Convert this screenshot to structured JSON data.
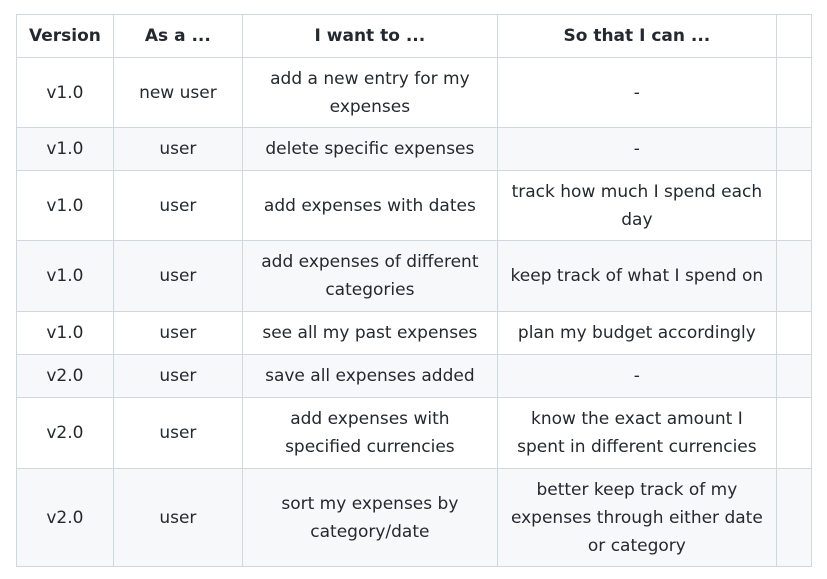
{
  "table": {
    "headers": [
      "Version",
      "As a ...",
      "I want to ...",
      "So that I can ...",
      ""
    ],
    "rows": [
      {
        "version": "v1.0",
        "as_a": "new user",
        "want": "add a new entry for my expenses",
        "so_that": "-"
      },
      {
        "version": "v1.0",
        "as_a": "user",
        "want": "delete specific expenses",
        "so_that": "-"
      },
      {
        "version": "v1.0",
        "as_a": "user",
        "want": "add expenses with dates",
        "so_that": "track how much I spend each day"
      },
      {
        "version": "v1.0",
        "as_a": "user",
        "want": "add expenses of different categories",
        "so_that": "keep track of what I spend on"
      },
      {
        "version": "v1.0",
        "as_a": "user",
        "want": "see all my past expenses",
        "so_that": "plan my budget accordingly"
      },
      {
        "version": "v2.0",
        "as_a": "user",
        "want": "save all expenses added",
        "so_that": "-"
      },
      {
        "version": "v2.0",
        "as_a": "user",
        "want": "add expenses with specified currencies",
        "so_that": "know the exact amount I spent in different currencies"
      },
      {
        "version": "v2.0",
        "as_a": "user",
        "want": "sort my expenses by category/date",
        "so_that": "better keep track of my expenses through either date or category"
      }
    ]
  }
}
